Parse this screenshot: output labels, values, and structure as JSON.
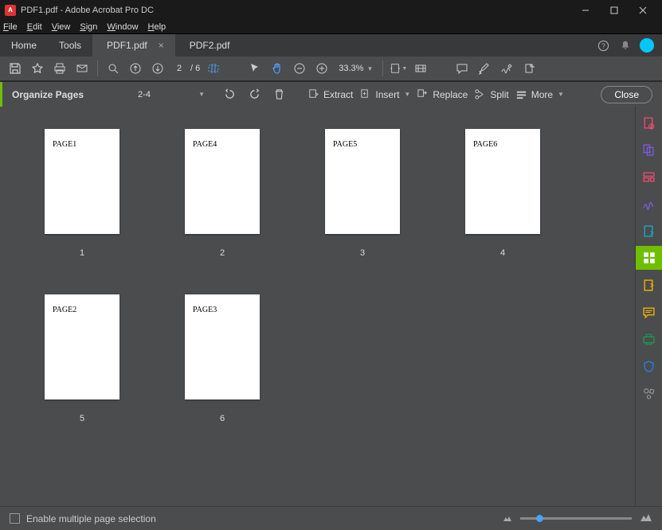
{
  "titlebar": {
    "title": "PDF1.pdf - Adobe Acrobat Pro DC"
  },
  "menubar": {
    "items": [
      "File",
      "Edit",
      "View",
      "Sign",
      "Window",
      "Help"
    ]
  },
  "tabbar": {
    "home": "Home",
    "tools": "Tools",
    "tabs": [
      {
        "label": "PDF1.pdf",
        "active": true
      },
      {
        "label": "PDF2.pdf",
        "active": false
      }
    ]
  },
  "toolbar": {
    "page_current": "2",
    "page_total": "/ 6",
    "zoom": "33.3%"
  },
  "orgbar": {
    "title": "Organize Pages",
    "range": "2-4",
    "extract": "Extract",
    "insert": "Insert",
    "replace": "Replace",
    "split": "Split",
    "more": "More",
    "close": "Close"
  },
  "pages": [
    {
      "label": "PAGE1",
      "num": "1",
      "selected": false
    },
    {
      "label": "PAGE4",
      "num": "2",
      "selected": true
    },
    {
      "label": "PAGE5",
      "num": "3",
      "selected": true
    },
    {
      "label": "PAGE6",
      "num": "4",
      "selected": true
    },
    {
      "label": "PAGE2",
      "num": "5",
      "selected": false
    },
    {
      "label": "PAGE3",
      "num": "6",
      "selected": false
    }
  ],
  "bottombar": {
    "checkbox_label": "Enable multiple page selection"
  }
}
